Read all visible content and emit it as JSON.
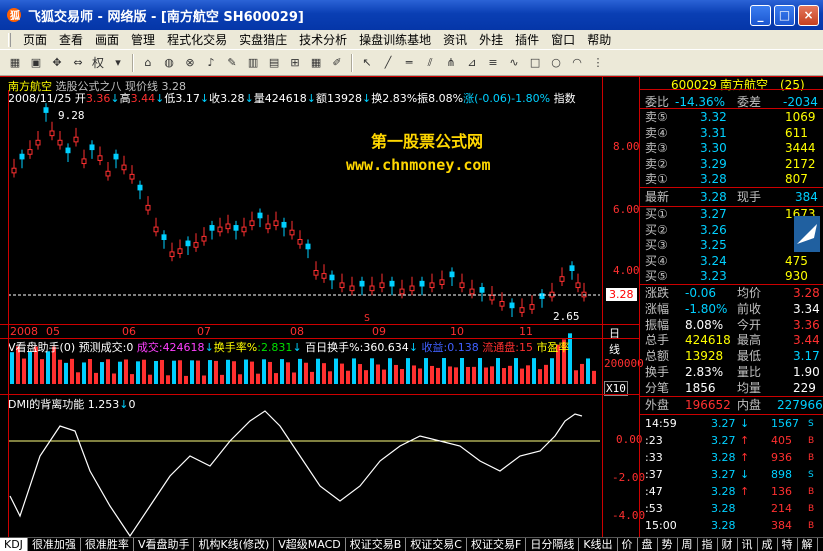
{
  "window": {
    "title": "飞狐交易师 - 网络版 - [南方航空 SH600029]",
    "buttons": {
      "min": "_",
      "max": "□",
      "close": "×"
    }
  },
  "menu": [
    "页面",
    "查看",
    "画面",
    "管理",
    "程式化交易",
    "实盘猎庄",
    "技术分析",
    "操盘训练基地",
    "资讯",
    "外挂",
    "插件",
    "窗口",
    "帮助"
  ],
  "toolbar": {
    "period_label": "权"
  },
  "chart": {
    "stock_name": "南方航空",
    "formula": "选股公式之八",
    "line_label": "现价线",
    "line_value": "3.28",
    "date": "2008/11/25",
    "open_label": "开",
    "open": "3.36",
    "high_label": "高",
    "high": "3.44",
    "low_label": "低",
    "low": "3.17",
    "close_label": "收",
    "close": "3.28",
    "vol_label": "量",
    "vol": "424618",
    "amt_label": "额",
    "amt": "13928",
    "turn_label": "换",
    "turn": "2.83%",
    "amp_label": "振",
    "amp": "8.08%",
    "chg_label": "涨",
    "chg": "(-0.06)-1.80%",
    "index_label": "指数",
    "peak_label": "9.28",
    "trough_label": "2.65",
    "last_price_tag": "3.28",
    "marker_s": "S",
    "y_ticks": [
      "8.00",
      "6.00",
      "4.00"
    ],
    "dates": [
      "2008",
      "05",
      "06",
      "07",
      "08",
      "09",
      "10",
      "11"
    ],
    "period": "日线"
  },
  "watermark": {
    "line1": "第一股票公式网",
    "line2": "www.chnmoney.com"
  },
  "volume": {
    "name": "V看盘助手",
    "param": "(0)",
    "forecast_label": "预测成交:0",
    "vol_label": "成交:",
    "vol": "424618",
    "turn_label": "换手率%",
    "turn": ":2.831",
    "day100_label": "百日换手%",
    "day100": ":360.634",
    "shares_label": "收益",
    "shares": ":0.138",
    "float_label": "流通盘",
    "float": ":15",
    "pe_label": "市盈率",
    "axis_value": "200000",
    "axis_unit": "X10"
  },
  "dmi": {
    "title": "DMI的背离功能",
    "value": "1.253",
    "extra": "0",
    "y_ticks": [
      "0.00",
      "-2.00",
      "-4.00"
    ]
  },
  "quote": {
    "code": "600029",
    "name": "南方航空",
    "rank": "(25)",
    "weibi_label": "委比",
    "weibi": "-14.36%",
    "weicha_label": "委差",
    "weicha": "-2034",
    "asks": [
      {
        "label": "卖⑤",
        "price": "3.32",
        "vol": "1069"
      },
      {
        "label": "卖④",
        "price": "3.31",
        "vol": "611"
      },
      {
        "label": "卖③",
        "price": "3.30",
        "vol": "3444"
      },
      {
        "label": "卖②",
        "price": "3.29",
        "vol": "2172"
      },
      {
        "label": "卖①",
        "price": "3.28",
        "vol": "807"
      }
    ],
    "latest_label": "最新",
    "latest": "3.28",
    "xianshou_label": "现手",
    "xianshou": "384",
    "bids": [
      {
        "label": "买①",
        "price": "3.27",
        "vol": "1673"
      },
      {
        "label": "买②",
        "price": "3.26",
        "vol": ""
      },
      {
        "label": "买③",
        "price": "3.25",
        "vol": ""
      },
      {
        "label": "买④",
        "price": "3.24",
        "vol": "475"
      },
      {
        "label": "买⑤",
        "price": "3.23",
        "vol": "930"
      }
    ],
    "stats": [
      {
        "l1": "涨跌",
        "v1": "-0.06",
        "l2": "均价",
        "v2": "3.28"
      },
      {
        "l1": "涨幅",
        "v1": "-1.80%",
        "l2": "前收",
        "v2": "3.34"
      },
      {
        "l1": "振幅",
        "v1": "8.08%",
        "l2": "今开",
        "v2": "3.36"
      },
      {
        "l1": "总手",
        "v1": "424618",
        "l2": "最高",
        "v2": "3.44"
      },
      {
        "l1": "总额",
        "v1": "13928",
        "l2": "最低",
        "v2": "3.17"
      },
      {
        "l1": "换手",
        "v1": "2.83%",
        "l2": "量比",
        "v2": "1.90"
      },
      {
        "l1": "分笔",
        "v1": "1856",
        "l2": "均量",
        "v2": "229"
      }
    ],
    "outer_label": "外盘",
    "outer": "196652",
    "inner_label": "内盘",
    "inner": "227966",
    "ticks": [
      {
        "time": "14:59",
        "price": "3.27",
        "arrow": "↓",
        "vol": "1567",
        "side": "S"
      },
      {
        "time": ":23",
        "price": "3.27",
        "arrow": "↑",
        "vol": "405",
        "side": "B"
      },
      {
        "time": ":33",
        "price": "3.28",
        "arrow": "↑",
        "vol": "936",
        "side": "B"
      },
      {
        "time": ":37",
        "price": "3.27",
        "arrow": "↓",
        "vol": "898",
        "side": "S"
      },
      {
        "time": ":47",
        "price": "3.28",
        "arrow": "↑",
        "vol": "136",
        "side": "B"
      },
      {
        "time": ":53",
        "price": "3.28",
        "arrow": "",
        "vol": "214",
        "side": "B"
      },
      {
        "time": "15:00",
        "price": "3.28",
        "arrow": "",
        "vol": "384",
        "side": "B"
      }
    ]
  },
  "tabs": [
    "KDJ",
    "很准加强",
    "很准胜率",
    "V看盘助手",
    "机构K线(修改)",
    "V超级MACD",
    "权证交易B",
    "权证交易C",
    "权证交易F",
    "日分隔线",
    "K线出",
    "价",
    "盘",
    "势",
    "周",
    "指",
    "财",
    "讯",
    "成",
    "特",
    "解"
  ],
  "colors": {
    "up": "#ff3030",
    "down": "#00d0ff",
    "bg": "#000000",
    "frame": "#c00000"
  }
}
